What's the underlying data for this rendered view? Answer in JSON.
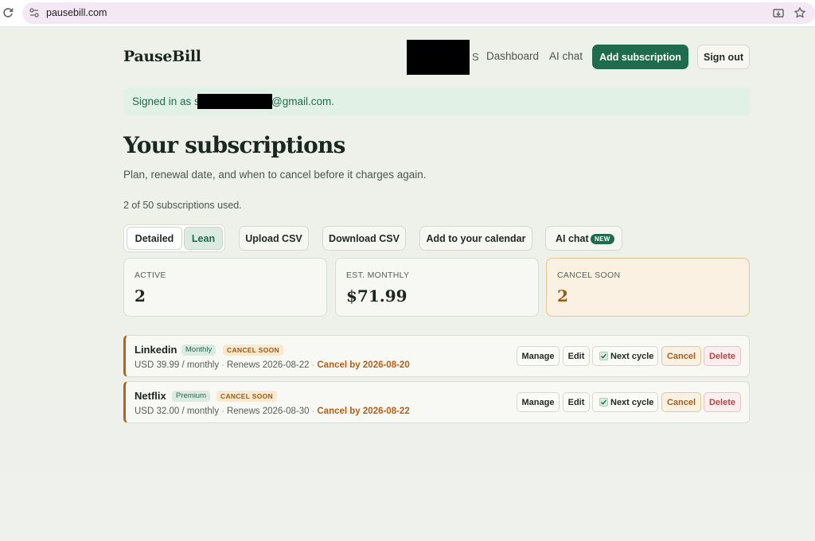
{
  "browser": {
    "url": "pausebill.com"
  },
  "header": {
    "logo": "PauseBill",
    "nav_initial": "S",
    "nav_dashboard": "Dashboard",
    "nav_aichat": "AI chat",
    "add_subscription": "Add subscription",
    "sign_out": "Sign out"
  },
  "banner": {
    "prefix": "Signed in as s",
    "suffix": "@gmail.com."
  },
  "page": {
    "title": "Your subscriptions",
    "subtitle": "Plan, renewal date, and when to cancel before it charges again.",
    "usage": "2 of 50 subscriptions used."
  },
  "toolbar": {
    "view_detailed": "Detailed",
    "view_lean": "Lean",
    "upload_csv": "Upload CSV",
    "download_csv": "Download CSV",
    "add_calendar": "Add to your calendar",
    "ai_chat": "AI chat",
    "ai_chat_badge": "NEW"
  },
  "stats": [
    {
      "label": "ACTIVE",
      "value": "2"
    },
    {
      "label": "EST. MONTHLY",
      "value": "$71.99"
    },
    {
      "label": "CANCEL SOON",
      "value": "2"
    }
  ],
  "subscriptions": [
    {
      "name": "Linkedin",
      "plan": "Monthly",
      "status": "CANCEL SOON",
      "price": "USD 39.99 / monthly",
      "renews": "Renews 2026-08-22",
      "cancel_by": "Cancel by 2026-08-20"
    },
    {
      "name": "Netflix",
      "plan": "Premium",
      "status": "CANCEL SOON",
      "price": "USD 32.00 / monthly",
      "renews": "Renews 2026-08-30",
      "cancel_by": "Cancel by 2026-08-22"
    }
  ],
  "row_actions": {
    "manage": "Manage",
    "edit": "Edit",
    "next_cycle": "Next cycle",
    "cancel": "Cancel",
    "delete": "Delete"
  },
  "colors": {
    "brand": "#1f6b4e",
    "warning": "#b0611a",
    "danger": "#b84545"
  }
}
